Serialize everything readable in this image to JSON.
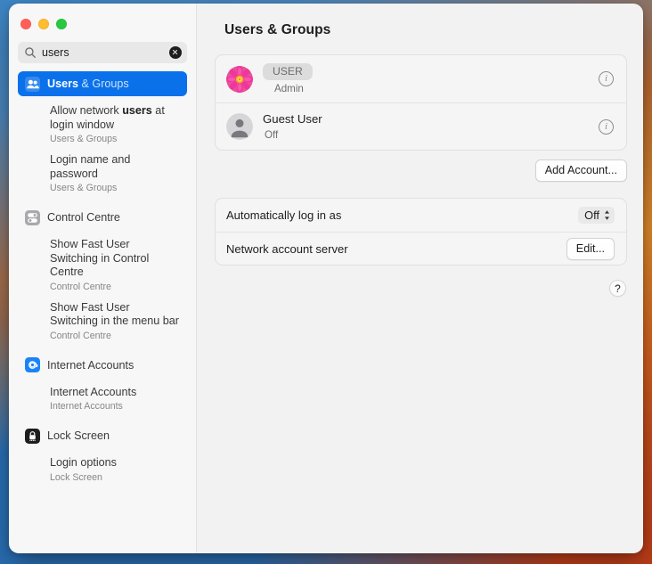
{
  "window": {
    "traffic_lights": [
      {
        "name": "close",
        "color": "#ff5f57"
      },
      {
        "name": "minimize",
        "color": "#febc2e"
      },
      {
        "name": "maximize",
        "color": "#28c840"
      }
    ]
  },
  "sidebar": {
    "search": {
      "value": "users",
      "placeholder": "Search",
      "icon": "search-icon",
      "clear_icon": "clear-icon"
    },
    "selected_pane": {
      "icon": "users-groups-icon",
      "label_match": "Users",
      "label_rest": " & Groups",
      "accent": "#0a71eb"
    },
    "groups": [
      {
        "results": [
          {
            "title_pre": "Allow network ",
            "title_match": "users",
            "title_post": " at login window",
            "subtitle": "Users & Groups"
          },
          {
            "title_pre": "Login name and password",
            "title_match": "",
            "title_post": "",
            "subtitle": "Users & Groups"
          }
        ]
      },
      {
        "pane": {
          "icon": "control-centre-icon",
          "label": "Control Centre"
        },
        "results": [
          {
            "title_pre": "Show Fast User Switching in Control Centre",
            "title_match": "",
            "title_post": "",
            "subtitle": "Control Centre"
          },
          {
            "title_pre": "Show Fast User Switching in the menu bar",
            "title_match": "",
            "title_post": "",
            "subtitle": "Control Centre"
          }
        ]
      },
      {
        "pane": {
          "icon": "internet-accounts-icon",
          "label": "Internet Accounts"
        },
        "results": [
          {
            "title_pre": "Internet Accounts",
            "title_match": "",
            "title_post": "",
            "subtitle": "Internet Accounts"
          }
        ]
      },
      {
        "pane": {
          "icon": "lock-screen-icon",
          "label": "Lock Screen"
        },
        "results": [
          {
            "title_pre": "Login options",
            "title_match": "",
            "title_post": "",
            "subtitle": "Lock Screen"
          }
        ]
      }
    ]
  },
  "main": {
    "title": "Users & Groups",
    "accounts": [
      {
        "avatar": "flower-avatar",
        "name": "USER",
        "name_redacted": true,
        "status": "Admin",
        "info_icon": "info-icon"
      },
      {
        "avatar": "guest-person-avatar",
        "name": "Guest User",
        "name_redacted": false,
        "status": "Off",
        "info_icon": "info-icon"
      }
    ],
    "add_account_label": "Add Account...",
    "settings": [
      {
        "label": "Automatically log in as",
        "control": "popup",
        "value": "Off",
        "control_icon": "chevron-up-down-icon"
      },
      {
        "label": "Network account server",
        "control": "button",
        "value": "Edit...",
        "control_icon": ""
      }
    ],
    "help_label": "?"
  }
}
